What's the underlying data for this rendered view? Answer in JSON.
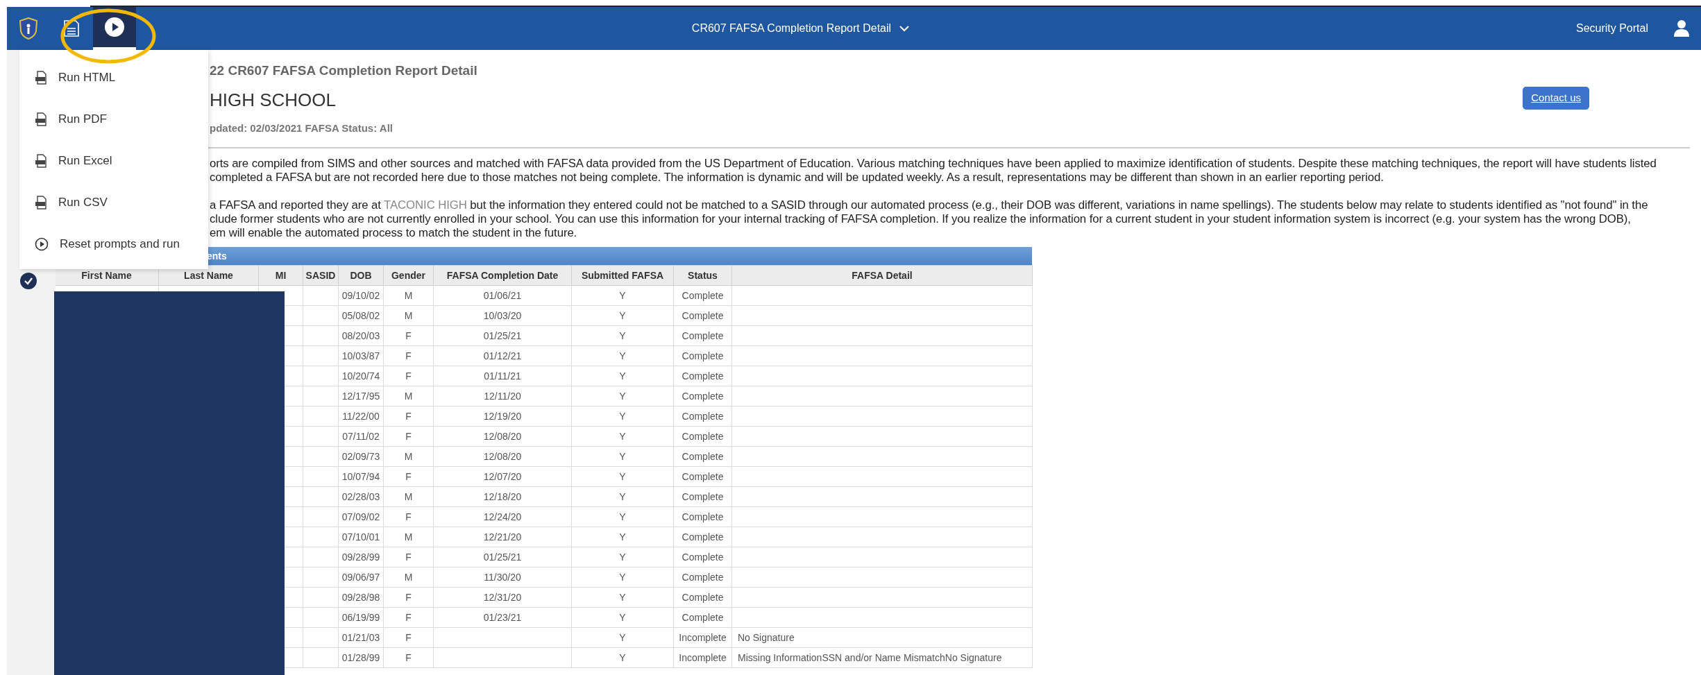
{
  "toolbar": [
    {
      "kind": "logo",
      "selected": false
    },
    {
      "kind": "document",
      "selected": false
    },
    {
      "kind": "play",
      "selected": true
    }
  ],
  "header": {
    "title": "CR607 FAFSA Completion Report Detail",
    "portal": "Security Portal"
  },
  "menu": {
    "items": [
      {
        "kind": "file",
        "label": "Run HTML"
      },
      {
        "kind": "file",
        "label": "Run PDF"
      },
      {
        "kind": "file",
        "label": "Run Excel"
      },
      {
        "kind": "file",
        "label": "Run CSV"
      },
      {
        "kind": "play",
        "label": "Reset prompts and run"
      }
    ]
  },
  "report": {
    "title": "22 CR607 FAFSA Completion Report Detail",
    "school": "HIGH SCHOOL",
    "updated": "pdated: 02/03/2021 FAFSA Status: All",
    "contact_button": "Contact us",
    "paragraphs": [
      [
        [
          {
            "text": "orts are compiled from SIMS and other sources and matched with FAFSA data provided from the US Department of Education. Various matching techniques have been applied to maximize identification of students. Despite these matching techniques, the report will have students listed",
            "muted": false
          }
        ],
        [
          {
            "text": "completed a FAFSA but are not recorded here due to those matches not being complete. The information is dynamic and will be updated weekly.  As a result, representations may be different than shown in an earlier reporting period.",
            "muted": false
          }
        ]
      ],
      [
        [
          {
            "text": "a FAFSA and reported they are at ",
            "muted": false
          },
          {
            "text": "TACONIC HIGH",
            "muted": true
          },
          {
            "text": " but the information they entered could not be matched to a SASID through our automated process (e.g., their DOB was different, variations in name spellings).  The students below may relate to students identified as \"not found\" in the",
            "muted": false
          }
        ],
        [
          {
            "text": "clude former students who are not currently enrolled in your school. You can use this information for your internal tracking of FAFSA completion. If you realize the information for a current student in your student information system is incorrect (e.g. your system has the wrong DOB),",
            "muted": false
          }
        ],
        [
          {
            "text": "em will enable the automated process to match the student in the future.",
            "muted": false
          }
        ]
      ]
    ]
  },
  "table": {
    "title": "ents",
    "columns": [
      "First Name",
      "Last Name",
      "MI",
      "SASID",
      "DOB",
      "Gender",
      "FAFSA Completion Date",
      "Submitted FAFSA",
      "Status",
      "FAFSA Detail"
    ],
    "rows": [
      {
        "dob": "09/10/02",
        "gender": "M",
        "date": "01/06/21",
        "submitted": "Y",
        "status": "Complete",
        "detail": ""
      },
      {
        "dob": "05/08/02",
        "gender": "M",
        "date": "10/03/20",
        "submitted": "Y",
        "status": "Complete",
        "detail": ""
      },
      {
        "dob": "08/20/03",
        "gender": "F",
        "date": "01/25/21",
        "submitted": "Y",
        "status": "Complete",
        "detail": ""
      },
      {
        "dob": "10/03/87",
        "gender": "F",
        "date": "01/12/21",
        "submitted": "Y",
        "status": "Complete",
        "detail": ""
      },
      {
        "dob": "10/20/74",
        "gender": "F",
        "date": "01/11/21",
        "submitted": "Y",
        "status": "Complete",
        "detail": ""
      },
      {
        "dob": "12/17/95",
        "gender": "M",
        "date": "12/11/20",
        "submitted": "Y",
        "status": "Complete",
        "detail": ""
      },
      {
        "dob": "11/22/00",
        "gender": "F",
        "date": "12/19/20",
        "submitted": "Y",
        "status": "Complete",
        "detail": ""
      },
      {
        "dob": "07/11/02",
        "gender": "F",
        "date": "12/08/20",
        "submitted": "Y",
        "status": "Complete",
        "detail": ""
      },
      {
        "dob": "02/09/73",
        "gender": "M",
        "date": "12/08/20",
        "submitted": "Y",
        "status": "Complete",
        "detail": ""
      },
      {
        "dob": "10/07/94",
        "gender": "F",
        "date": "12/07/20",
        "submitted": "Y",
        "status": "Complete",
        "detail": ""
      },
      {
        "dob": "02/28/03",
        "gender": "M",
        "date": "12/18/20",
        "submitted": "Y",
        "status": "Complete",
        "detail": ""
      },
      {
        "dob": "07/09/02",
        "gender": "F",
        "date": "12/24/20",
        "submitted": "Y",
        "status": "Complete",
        "detail": ""
      },
      {
        "dob": "07/10/01",
        "gender": "M",
        "date": "12/21/20",
        "submitted": "Y",
        "status": "Complete",
        "detail": ""
      },
      {
        "dob": "09/28/99",
        "gender": "F",
        "date": "01/25/21",
        "submitted": "Y",
        "status": "Complete",
        "detail": ""
      },
      {
        "dob": "09/06/97",
        "gender": "M",
        "date": "11/30/20",
        "submitted": "Y",
        "status": "Complete",
        "detail": ""
      },
      {
        "dob": "09/28/98",
        "gender": "F",
        "date": "12/31/20",
        "submitted": "Y",
        "status": "Complete",
        "detail": ""
      },
      {
        "dob": "06/19/99",
        "gender": "F",
        "date": "01/23/21",
        "submitted": "Y",
        "status": "Complete",
        "detail": ""
      },
      {
        "dob": "01/21/03",
        "gender": "F",
        "date": "",
        "submitted": "Y",
        "status": "Incomplete",
        "detail": "No Signature"
      },
      {
        "dob": "01/28/99",
        "gender": "F",
        "date": "",
        "submitted": "Y",
        "status": "Incomplete",
        "detail": "Missing InformationSSN and/or Name MismatchNo Signature"
      }
    ]
  }
}
